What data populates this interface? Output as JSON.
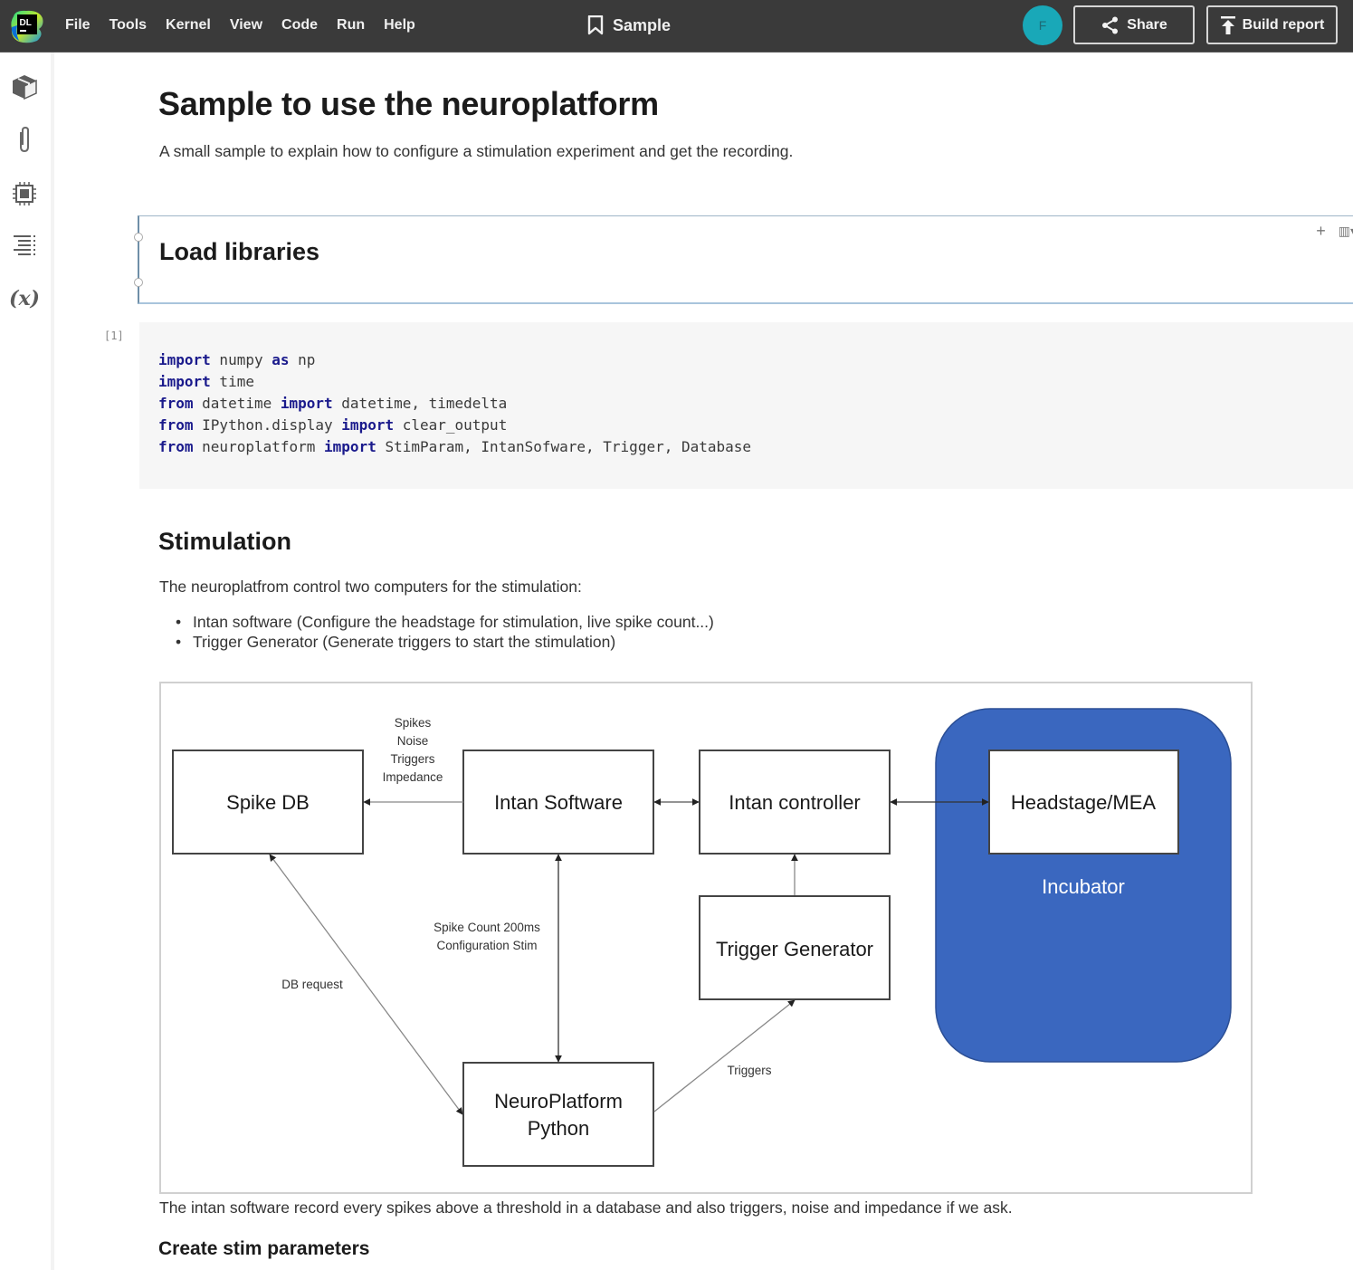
{
  "app": {
    "logo_text": "DL",
    "menu": [
      "File",
      "Tools",
      "Kernel",
      "View",
      "Code",
      "Run",
      "Help"
    ],
    "document_title": "Sample",
    "avatar_initial": "F",
    "share_label": "Share",
    "build_report_label": "Build report",
    "colors": {
      "topbar": "#3a3a3a",
      "avatar": "#19a8b8",
      "incubator": "#3a67bf",
      "keyword": "#1a1a8c"
    }
  },
  "sidebar": {
    "items": [
      {
        "icon": "package-icon",
        "label": "Environment"
      },
      {
        "icon": "paperclip-icon",
        "label": "Attachments"
      },
      {
        "icon": "chip-icon",
        "label": "Hardware"
      },
      {
        "icon": "table-of-contents-icon",
        "label": "Table of contents"
      },
      {
        "icon": "variables-icon",
        "label": "(x)"
      }
    ]
  },
  "notebook": {
    "title": "Sample to use the neuroplatform",
    "intro": "A small sample to explain how to configure a stimulation experiment and get the recording.",
    "cells": {
      "load_libraries": {
        "heading": "Load libraries",
        "tools": {
          "add": "+",
          "layout": "▥▾"
        }
      },
      "code1": {
        "exec_count": "[1]",
        "lines": [
          [
            {
              "t": "import",
              "k": true
            },
            {
              "t": " numpy "
            },
            {
              "t": "as",
              "k": true
            },
            {
              "t": " np"
            }
          ],
          [
            {
              "t": "import",
              "k": true
            },
            {
              "t": " time"
            }
          ],
          [
            {
              "t": "from",
              "k": true
            },
            {
              "t": " datetime "
            },
            {
              "t": "import",
              "k": true
            },
            {
              "t": " datetime, timedelta"
            }
          ],
          [
            {
              "t": "from",
              "k": true
            },
            {
              "t": " IPython.display "
            },
            {
              "t": "import",
              "k": true
            },
            {
              "t": " clear_output"
            }
          ],
          [
            {
              "t": "from",
              "k": true
            },
            {
              "t": " neuroplatform "
            },
            {
              "t": "import",
              "k": true
            },
            {
              "t": " StimParam, IntanSofware, Trigger, Database"
            }
          ]
        ]
      },
      "stimulation": {
        "heading": "Stimulation",
        "paragraph": "The neuroplatfrom control two computers for the stimulation:",
        "bullets": [
          "Intan software (Configure the headstage for stimulation, live spike count...)",
          "Trigger Generator (Generate triggers to start the stimulation)"
        ],
        "diagram": {
          "nodes": {
            "spike_db": "Spike DB",
            "intan_software": "Intan Software",
            "intan_controller": "Intan controller",
            "headstage": "Headstage/MEA",
            "incubator": "Incubator",
            "trigger_generator": "Trigger Generator",
            "neuroplatform_line1": "NeuroPlatform",
            "neuroplatform_line2": "Python"
          },
          "edges": {
            "spikes_labels": [
              "Spikes",
              "Noise",
              "Triggers",
              "Impedance"
            ],
            "spike_count_labels": [
              "Spike Count 200ms",
              "Configuration Stim"
            ],
            "db_request": "DB request",
            "triggers": "Triggers"
          }
        },
        "caption": "The intan software record every spikes above a threshold in a database and also triggers, noise and impedance if we ask."
      },
      "next_heading": "Create stim parameters"
    }
  }
}
